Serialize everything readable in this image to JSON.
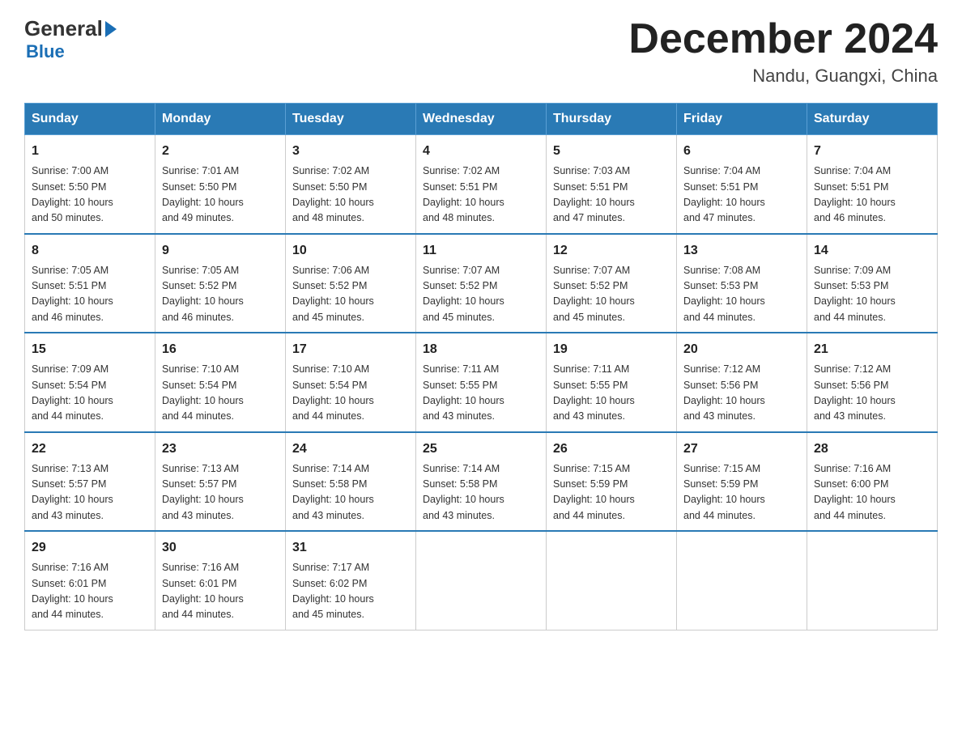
{
  "header": {
    "logo_general": "General",
    "logo_blue": "Blue",
    "main_title": "December 2024",
    "subtitle": "Nandu, Guangxi, China"
  },
  "calendar": {
    "days_of_week": [
      "Sunday",
      "Monday",
      "Tuesday",
      "Wednesday",
      "Thursday",
      "Friday",
      "Saturday"
    ],
    "weeks": [
      {
        "divider": false,
        "days": [
          {
            "date": "1",
            "sunrise": "7:00 AM",
            "sunset": "5:50 PM",
            "daylight": "10 hours and 50 minutes."
          },
          {
            "date": "2",
            "sunrise": "7:01 AM",
            "sunset": "5:50 PM",
            "daylight": "10 hours and 49 minutes."
          },
          {
            "date": "3",
            "sunrise": "7:02 AM",
            "sunset": "5:50 PM",
            "daylight": "10 hours and 48 minutes."
          },
          {
            "date": "4",
            "sunrise": "7:02 AM",
            "sunset": "5:51 PM",
            "daylight": "10 hours and 48 minutes."
          },
          {
            "date": "5",
            "sunrise": "7:03 AM",
            "sunset": "5:51 PM",
            "daylight": "10 hours and 47 minutes."
          },
          {
            "date": "6",
            "sunrise": "7:04 AM",
            "sunset": "5:51 PM",
            "daylight": "10 hours and 47 minutes."
          },
          {
            "date": "7",
            "sunrise": "7:04 AM",
            "sunset": "5:51 PM",
            "daylight": "10 hours and 46 minutes."
          }
        ]
      },
      {
        "divider": true,
        "days": [
          {
            "date": "8",
            "sunrise": "7:05 AM",
            "sunset": "5:51 PM",
            "daylight": "10 hours and 46 minutes."
          },
          {
            "date": "9",
            "sunrise": "7:05 AM",
            "sunset": "5:52 PM",
            "daylight": "10 hours and 46 minutes."
          },
          {
            "date": "10",
            "sunrise": "7:06 AM",
            "sunset": "5:52 PM",
            "daylight": "10 hours and 45 minutes."
          },
          {
            "date": "11",
            "sunrise": "7:07 AM",
            "sunset": "5:52 PM",
            "daylight": "10 hours and 45 minutes."
          },
          {
            "date": "12",
            "sunrise": "7:07 AM",
            "sunset": "5:52 PM",
            "daylight": "10 hours and 45 minutes."
          },
          {
            "date": "13",
            "sunrise": "7:08 AM",
            "sunset": "5:53 PM",
            "daylight": "10 hours and 44 minutes."
          },
          {
            "date": "14",
            "sunrise": "7:09 AM",
            "sunset": "5:53 PM",
            "daylight": "10 hours and 44 minutes."
          }
        ]
      },
      {
        "divider": true,
        "days": [
          {
            "date": "15",
            "sunrise": "7:09 AM",
            "sunset": "5:54 PM",
            "daylight": "10 hours and 44 minutes."
          },
          {
            "date": "16",
            "sunrise": "7:10 AM",
            "sunset": "5:54 PM",
            "daylight": "10 hours and 44 minutes."
          },
          {
            "date": "17",
            "sunrise": "7:10 AM",
            "sunset": "5:54 PM",
            "daylight": "10 hours and 44 minutes."
          },
          {
            "date": "18",
            "sunrise": "7:11 AM",
            "sunset": "5:55 PM",
            "daylight": "10 hours and 43 minutes."
          },
          {
            "date": "19",
            "sunrise": "7:11 AM",
            "sunset": "5:55 PM",
            "daylight": "10 hours and 43 minutes."
          },
          {
            "date": "20",
            "sunrise": "7:12 AM",
            "sunset": "5:56 PM",
            "daylight": "10 hours and 43 minutes."
          },
          {
            "date": "21",
            "sunrise": "7:12 AM",
            "sunset": "5:56 PM",
            "daylight": "10 hours and 43 minutes."
          }
        ]
      },
      {
        "divider": true,
        "days": [
          {
            "date": "22",
            "sunrise": "7:13 AM",
            "sunset": "5:57 PM",
            "daylight": "10 hours and 43 minutes."
          },
          {
            "date": "23",
            "sunrise": "7:13 AM",
            "sunset": "5:57 PM",
            "daylight": "10 hours and 43 minutes."
          },
          {
            "date": "24",
            "sunrise": "7:14 AM",
            "sunset": "5:58 PM",
            "daylight": "10 hours and 43 minutes."
          },
          {
            "date": "25",
            "sunrise": "7:14 AM",
            "sunset": "5:58 PM",
            "daylight": "10 hours and 43 minutes."
          },
          {
            "date": "26",
            "sunrise": "7:15 AM",
            "sunset": "5:59 PM",
            "daylight": "10 hours and 44 minutes."
          },
          {
            "date": "27",
            "sunrise": "7:15 AM",
            "sunset": "5:59 PM",
            "daylight": "10 hours and 44 minutes."
          },
          {
            "date": "28",
            "sunrise": "7:16 AM",
            "sunset": "6:00 PM",
            "daylight": "10 hours and 44 minutes."
          }
        ]
      },
      {
        "divider": true,
        "days": [
          {
            "date": "29",
            "sunrise": "7:16 AM",
            "sunset": "6:01 PM",
            "daylight": "10 hours and 44 minutes."
          },
          {
            "date": "30",
            "sunrise": "7:16 AM",
            "sunset": "6:01 PM",
            "daylight": "10 hours and 44 minutes."
          },
          {
            "date": "31",
            "sunrise": "7:17 AM",
            "sunset": "6:02 PM",
            "daylight": "10 hours and 45 minutes."
          },
          null,
          null,
          null,
          null
        ]
      }
    ]
  },
  "labels": {
    "sunrise_prefix": "Sunrise: ",
    "sunset_prefix": "Sunset: ",
    "daylight_prefix": "Daylight: "
  }
}
